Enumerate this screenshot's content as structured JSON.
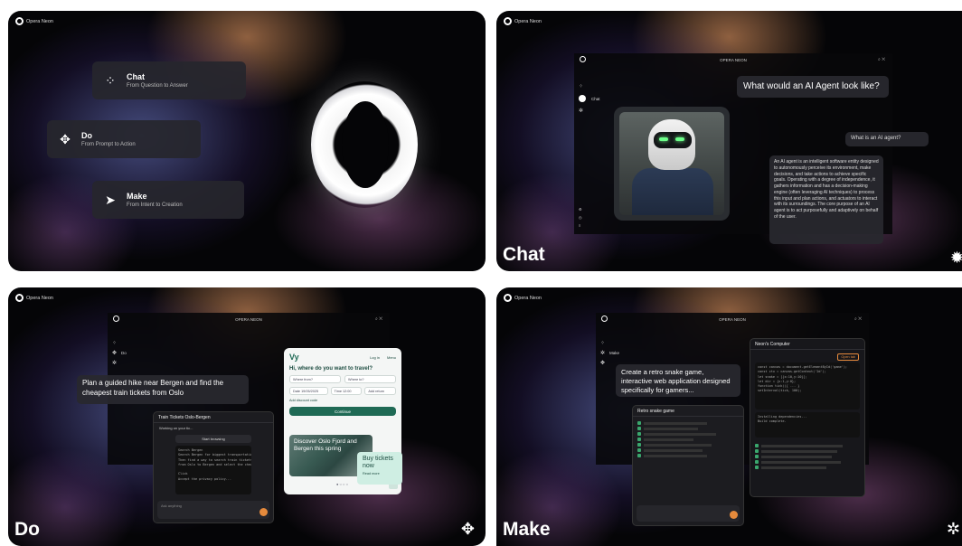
{
  "brand": "Opera Neon",
  "app_title": "OPERA NEON",
  "menu": [
    {
      "title": "Chat",
      "subtitle": "From Question to Answer",
      "icon": "chat-dots-icon"
    },
    {
      "title": "Do",
      "subtitle": "From Prompt to Action",
      "icon": "do-arrows-icon"
    },
    {
      "title": "Make",
      "subtitle": "From Intent to Creation",
      "icon": "make-arrow-icon"
    }
  ],
  "chat": {
    "label": "Chat",
    "side_label": "Chat",
    "prompt": "What would an AI Agent look like?",
    "question": "What is an AI agent?",
    "answer": "An AI agent is an intelligent software entity designed to autonomously perceive its environment, make decisions, and take actions to achieve specific goals. Operating with a degree of independence, it gathers information and has a decision-making engine (often leveraging AI techniques) to process this input and plan actions, and actuators to interact with its surroundings. The core purpose of an AI agent is to act purposefully and adaptively on behalf of the user."
  },
  "do": {
    "label": "Do",
    "side_label": "Do",
    "prompt": "Plan a guided hike near Bergen and find the cheapest train tickets from Oslo",
    "task_title": "Train Tickets Oslo-Bergen",
    "task_status": "Working on your tic...",
    "thinking": "Start browsing",
    "site": {
      "login": "Log in",
      "menu": "Menu",
      "heading": "Hi, where do you want to travel?",
      "from_placeholder": "Where from?",
      "to_placeholder": "Where to?",
      "date": "Date 19/05/2025",
      "time": "Time 12:00",
      "add_return": "Add return",
      "discount": "Add discount code",
      "continue": "Continue",
      "promo": "Discover Oslo Fjord and Bergen this spring",
      "buy": "Buy tickets now",
      "read_more": "Read more"
    },
    "input_placeholder": "Ask anything"
  },
  "make": {
    "label": "Make",
    "side_label": "Make",
    "prompt": "Create a retro snake game, interactive web application designed specifically for gamers...",
    "task_title": "Retro snake game",
    "computer_title": "Neon's Computer",
    "computer_action": "Open tab"
  }
}
